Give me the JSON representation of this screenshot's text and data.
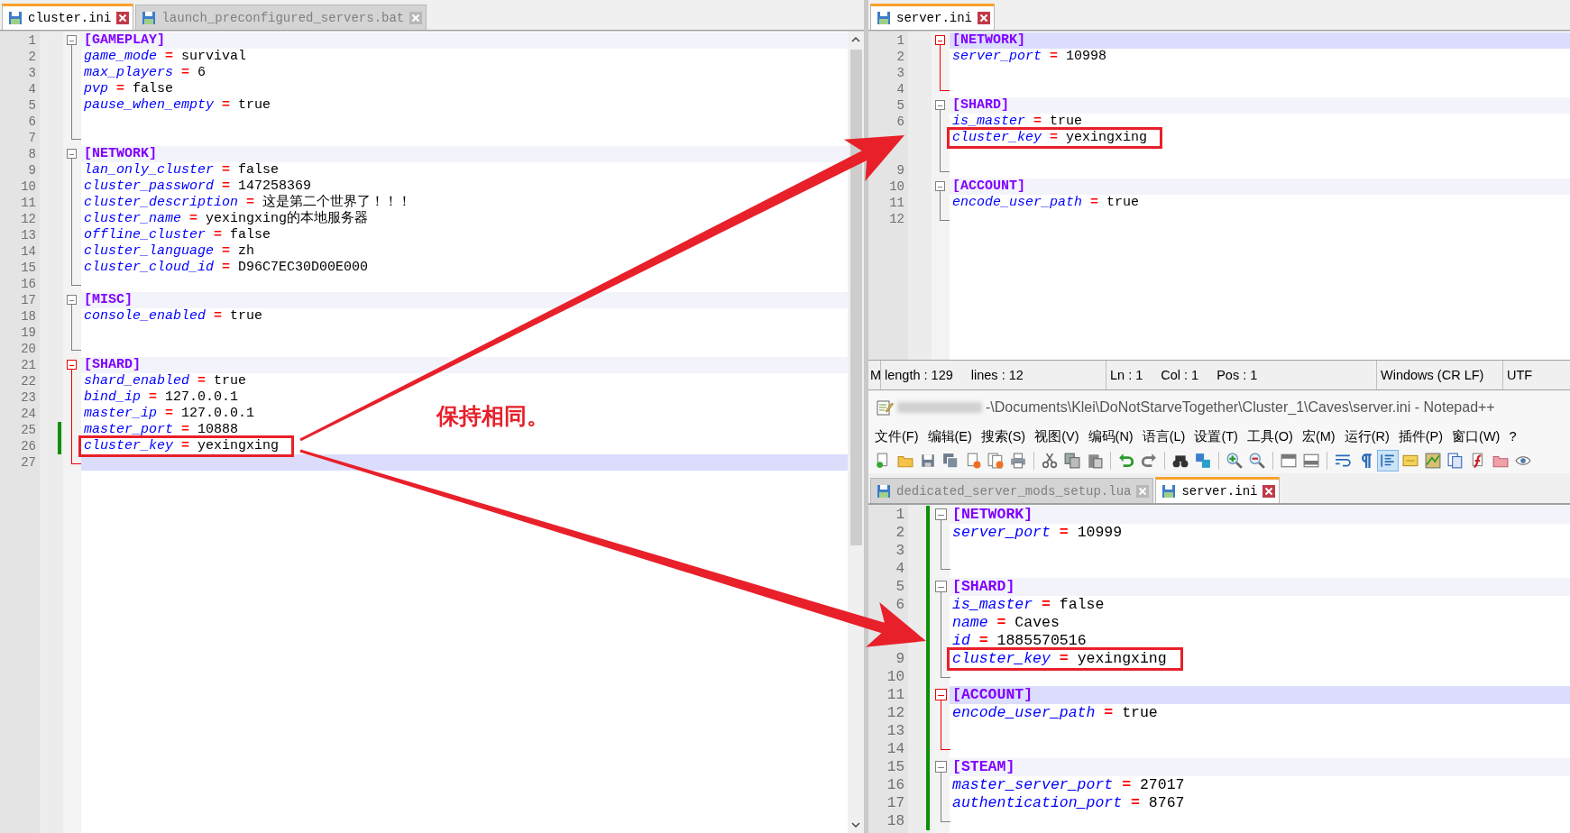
{
  "left_pane": {
    "tabs": [
      {
        "label": "cluster.ini",
        "selected": true
      },
      {
        "label": "launch_preconfigured_servers.bat",
        "selected": false
      }
    ],
    "lines": [
      {
        "n": "1",
        "kind": "section",
        "text": "[GAMEPLAY]",
        "fold_active": false,
        "current": false,
        "changed": false,
        "boxed": false
      },
      {
        "n": "2",
        "kind": "pair",
        "key": "game_mode",
        "op": "=",
        "value": "survival",
        "current": false,
        "changed": false,
        "boxed": false
      },
      {
        "n": "3",
        "kind": "pair",
        "key": "max_players",
        "op": "=",
        "value": "6",
        "current": false,
        "changed": false,
        "boxed": false
      },
      {
        "n": "4",
        "kind": "pair",
        "key": "pvp",
        "op": "=",
        "value": "false",
        "current": false,
        "changed": false,
        "boxed": false
      },
      {
        "n": "5",
        "kind": "pair",
        "key": "pause_when_empty",
        "op": "=",
        "value": "true",
        "current": false,
        "changed": false,
        "boxed": false
      },
      {
        "n": "6",
        "kind": "blank",
        "current": false,
        "changed": false,
        "boxed": false
      },
      {
        "n": "7",
        "kind": "blank",
        "current": false,
        "changed": false,
        "boxed": false
      },
      {
        "n": "8",
        "kind": "section",
        "text": "[NETWORK]",
        "fold_active": false,
        "current": false,
        "changed": false,
        "boxed": false
      },
      {
        "n": "9",
        "kind": "pair",
        "key": "lan_only_cluster",
        "op": "=",
        "value": "false",
        "current": false,
        "changed": false,
        "boxed": false
      },
      {
        "n": "10",
        "kind": "pair",
        "key": "cluster_password",
        "op": "=",
        "value": "147258369",
        "current": false,
        "changed": false,
        "boxed": false
      },
      {
        "n": "11",
        "kind": "pair",
        "key": "cluster_description",
        "op": "=",
        "value": "这是第二个世界了！！！",
        "current": false,
        "changed": false,
        "boxed": false
      },
      {
        "n": "12",
        "kind": "pair",
        "key": "cluster_name",
        "op": "=",
        "value": "yexingxing的本地服务器",
        "current": false,
        "changed": false,
        "boxed": false
      },
      {
        "n": "13",
        "kind": "pair",
        "key": "offline_cluster",
        "op": "=",
        "value": "false",
        "current": false,
        "changed": false,
        "boxed": false
      },
      {
        "n": "14",
        "kind": "pair",
        "key": "cluster_language",
        "op": "=",
        "value": "zh",
        "current": false,
        "changed": false,
        "boxed": false
      },
      {
        "n": "15",
        "kind": "pair",
        "key": "cluster_cloud_id",
        "op": "=",
        "value": "D96C7EC30D00E000",
        "current": false,
        "changed": false,
        "boxed": false
      },
      {
        "n": "16",
        "kind": "blank",
        "current": false,
        "changed": false,
        "boxed": false
      },
      {
        "n": "17",
        "kind": "section",
        "text": "[MISC]",
        "fold_active": false,
        "current": false,
        "changed": false,
        "boxed": false
      },
      {
        "n": "18",
        "kind": "pair",
        "key": "console_enabled",
        "op": "=",
        "value": "true",
        "current": false,
        "changed": false,
        "boxed": false
      },
      {
        "n": "19",
        "kind": "blank",
        "current": false,
        "changed": false,
        "boxed": false
      },
      {
        "n": "20",
        "kind": "blank",
        "current": false,
        "changed": false,
        "boxed": false
      },
      {
        "n": "21",
        "kind": "section",
        "text": "[SHARD]",
        "fold_active": true,
        "current": false,
        "changed": false,
        "boxed": false
      },
      {
        "n": "22",
        "kind": "pair",
        "key": "shard_enabled",
        "op": "=",
        "value": "true",
        "current": false,
        "changed": false,
        "boxed": false
      },
      {
        "n": "23",
        "kind": "pair",
        "key": "bind_ip",
        "op": "=",
        "value": "127.0.0.1",
        "current": false,
        "changed": false,
        "boxed": false
      },
      {
        "n": "24",
        "kind": "pair",
        "key": "master_ip",
        "op": "=",
        "value": "127.0.0.1",
        "current": false,
        "changed": false,
        "boxed": false
      },
      {
        "n": "25",
        "kind": "pair",
        "key": "master_port",
        "op": "=",
        "value": "10888",
        "current": false,
        "changed": true,
        "boxed": false
      },
      {
        "n": "26",
        "kind": "pair",
        "key": "cluster_key",
        "op": "=",
        "value": "yexingxing",
        "current": false,
        "changed": true,
        "boxed": true
      },
      {
        "n": "27",
        "kind": "blank",
        "current": true,
        "changed": false,
        "boxed": false
      }
    ]
  },
  "right_top_pane": {
    "tabs": [
      {
        "label": "server.ini",
        "selected": true
      }
    ],
    "lines": [
      {
        "n": "1",
        "kind": "section",
        "text": "[NETWORK]",
        "fold_active": true,
        "current": true,
        "changed": false,
        "boxed": false
      },
      {
        "n": "2",
        "kind": "pair",
        "key": "server_port",
        "op": "=",
        "value": "10998",
        "current": false,
        "changed": false,
        "boxed": false
      },
      {
        "n": "3",
        "kind": "blank",
        "current": false,
        "changed": false,
        "boxed": false
      },
      {
        "n": "4",
        "kind": "blank",
        "current": false,
        "changed": false,
        "boxed": false
      },
      {
        "n": "5",
        "kind": "section",
        "text": "[SHARD]",
        "fold_active": false,
        "current": false,
        "changed": false,
        "boxed": false
      },
      {
        "n": "6",
        "kind": "pair",
        "key": "is_master",
        "op": "=",
        "value": "true",
        "current": false,
        "changed": false,
        "boxed": false
      },
      {
        "kind": "pair",
        "key": "cluster_key",
        "op": "=",
        "value": "yexingxing",
        "current": false,
        "changed": false,
        "boxed": true
      },
      {
        "kind": "blank",
        "current": false,
        "changed": false,
        "boxed": false
      },
      {
        "n": "9",
        "kind": "blank",
        "current": false,
        "changed": false,
        "boxed": false
      },
      {
        "n": "10",
        "kind": "section",
        "text": "[ACCOUNT]",
        "fold_active": false,
        "current": false,
        "changed": false,
        "boxed": false
      },
      {
        "n": "11",
        "kind": "pair",
        "key": "encode_user_path",
        "op": "=",
        "value": "true",
        "current": false,
        "changed": false,
        "boxed": false
      },
      {
        "n": "12",
        "kind": "blank",
        "current": false,
        "changed": false,
        "boxed": false
      }
    ]
  },
  "status_bar": [
    {
      "items": [
        "M"
      ]
    },
    {
      "items": [
        "length : 129",
        "lines : 12"
      ]
    },
    {
      "items": [
        "Ln : 1",
        "Col : 1",
        "Pos : 1"
      ]
    },
    {
      "items": [
        "Windows (CR LF)"
      ]
    },
    {
      "items": [
        "UTF"
      ]
    }
  ],
  "title_bar": {
    "title": "-\\Documents\\Klei\\DoNotStarveTogether\\Cluster_1\\Caves\\server.ini - Notepad++"
  },
  "menu": [
    "文件(F)",
    "编辑(E)",
    "搜索(S)",
    "视图(V)",
    "编码(N)",
    "语言(L)",
    "设置(T)",
    "工具(O)",
    "宏(M)",
    "运行(R)",
    "插件(P)",
    "窗口(W)",
    "?"
  ],
  "toolbar": [
    {
      "buttons": [
        {
          "kind": "new",
          "on": false
        },
        {
          "kind": "open",
          "on": false
        },
        {
          "kind": "save",
          "on": false
        },
        {
          "kind": "saveall",
          "on": false
        },
        {
          "kind": "close",
          "on": false
        },
        {
          "kind": "closeall",
          "on": false
        },
        {
          "kind": "print",
          "on": false
        }
      ]
    },
    {
      "buttons": [
        {
          "kind": "cut",
          "on": false
        },
        {
          "kind": "copy",
          "on": false
        },
        {
          "kind": "paste",
          "on": false
        }
      ]
    },
    {
      "buttons": [
        {
          "kind": "undo",
          "on": false
        },
        {
          "kind": "redo",
          "on": false
        }
      ]
    },
    {
      "buttons": [
        {
          "kind": "find",
          "on": false
        },
        {
          "kind": "replace",
          "on": false
        }
      ]
    },
    {
      "buttons": [
        {
          "kind": "zoomin",
          "on": false
        },
        {
          "kind": "zoomout",
          "on": false
        }
      ]
    },
    {
      "buttons": [
        {
          "kind": "syncv",
          "on": false
        },
        {
          "kind": "synch",
          "on": false
        }
      ]
    },
    {
      "buttons": [
        {
          "kind": "wrap",
          "on": false
        },
        {
          "kind": "allchars",
          "on": false
        },
        {
          "kind": "indent",
          "on": true
        },
        {
          "kind": "udl",
          "on": false
        },
        {
          "kind": "docmap",
          "on": false
        },
        {
          "kind": "doclist",
          "on": false
        },
        {
          "kind": "funclist",
          "on": false
        },
        {
          "kind": "folder",
          "on": false
        },
        {
          "kind": "monitor",
          "on": false
        }
      ]
    }
  ],
  "right_bottom_pane": {
    "tabs": [
      {
        "label": "dedicated_server_mods_setup.lua",
        "selected": false
      },
      {
        "label": "server.ini",
        "selected": true
      }
    ],
    "lines": [
      {
        "n": "1",
        "kind": "section",
        "text": "[NETWORK]",
        "fold_active": false,
        "current": false,
        "changed": true,
        "boxed": false
      },
      {
        "n": "2",
        "kind": "pair",
        "key": "server_port",
        "op": "=",
        "value": "10999",
        "current": false,
        "changed": true,
        "boxed": false
      },
      {
        "n": "3",
        "kind": "blank",
        "current": false,
        "changed": true,
        "boxed": false
      },
      {
        "n": "4",
        "kind": "blank",
        "current": false,
        "changed": true,
        "boxed": false
      },
      {
        "n": "5",
        "kind": "section",
        "text": "[SHARD]",
        "fold_active": false,
        "current": false,
        "changed": true,
        "boxed": false
      },
      {
        "n": "6",
        "kind": "pair",
        "key": "is_master",
        "op": "=",
        "value": "false",
        "current": false,
        "changed": true,
        "boxed": false
      },
      {
        "kind": "pair",
        "key": "name",
        "op": "=",
        "value": "Caves",
        "current": false,
        "changed": true,
        "boxed": false
      },
      {
        "kind": "pair",
        "key": "id",
        "op": "=",
        "value": "1885570516",
        "current": false,
        "changed": true,
        "boxed": false
      },
      {
        "n": "9",
        "kind": "pair",
        "key": "cluster_key",
        "op": "=",
        "value": "yexingxing",
        "current": false,
        "changed": true,
        "boxed": true
      },
      {
        "n": "10",
        "kind": "blank",
        "current": false,
        "changed": true,
        "boxed": false
      },
      {
        "n": "11",
        "kind": "section",
        "text": "[ACCOUNT]",
        "fold_active": true,
        "current": true,
        "changed": true,
        "boxed": false
      },
      {
        "n": "12",
        "kind": "pair",
        "key": "encode_user_path",
        "op": "=",
        "value": "true",
        "current": false,
        "changed": true,
        "boxed": false
      },
      {
        "n": "13",
        "kind": "blank",
        "current": false,
        "changed": true,
        "boxed": false
      },
      {
        "n": "14",
        "kind": "blank",
        "current": false,
        "changed": true,
        "boxed": false
      },
      {
        "n": "15",
        "kind": "section",
        "text": "[STEAM]",
        "fold_active": false,
        "current": false,
        "changed": true,
        "boxed": false
      },
      {
        "n": "16",
        "kind": "pair",
        "key": "master_server_port",
        "op": "=",
        "value": "27017",
        "current": false,
        "changed": true,
        "boxed": false
      },
      {
        "n": "17",
        "kind": "pair",
        "key": "authentication_port",
        "op": "=",
        "value": "8767",
        "current": false,
        "changed": true,
        "boxed": false
      },
      {
        "n": "18",
        "kind": "blank",
        "current": false,
        "changed": true,
        "boxed": false
      }
    ]
  },
  "annotation": {
    "text": "保持相同。"
  }
}
